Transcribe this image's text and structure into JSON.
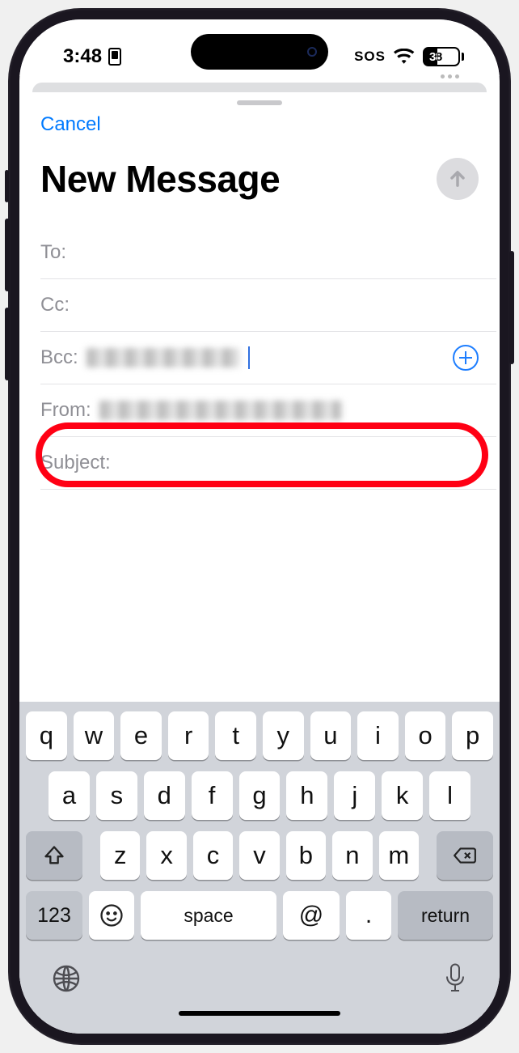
{
  "status": {
    "time": "3:48",
    "sos": "SOS",
    "battery": "38"
  },
  "sheet": {
    "cancel": "Cancel",
    "title": "New Message",
    "fields": {
      "to_label": "To:",
      "cc_label": "Cc:",
      "bcc_label": "Bcc:",
      "from_label": "From:",
      "subject_label": "Subject:"
    }
  },
  "keyboard": {
    "row1": [
      "q",
      "w",
      "e",
      "r",
      "t",
      "y",
      "u",
      "i",
      "o",
      "p"
    ],
    "row2": [
      "a",
      "s",
      "d",
      "f",
      "g",
      "h",
      "j",
      "k",
      "l"
    ],
    "row3": [
      "z",
      "x",
      "c",
      "v",
      "b",
      "n",
      "m"
    ],
    "num": "123",
    "space": "space",
    "at": "@",
    "dot": ".",
    "return": "return"
  }
}
